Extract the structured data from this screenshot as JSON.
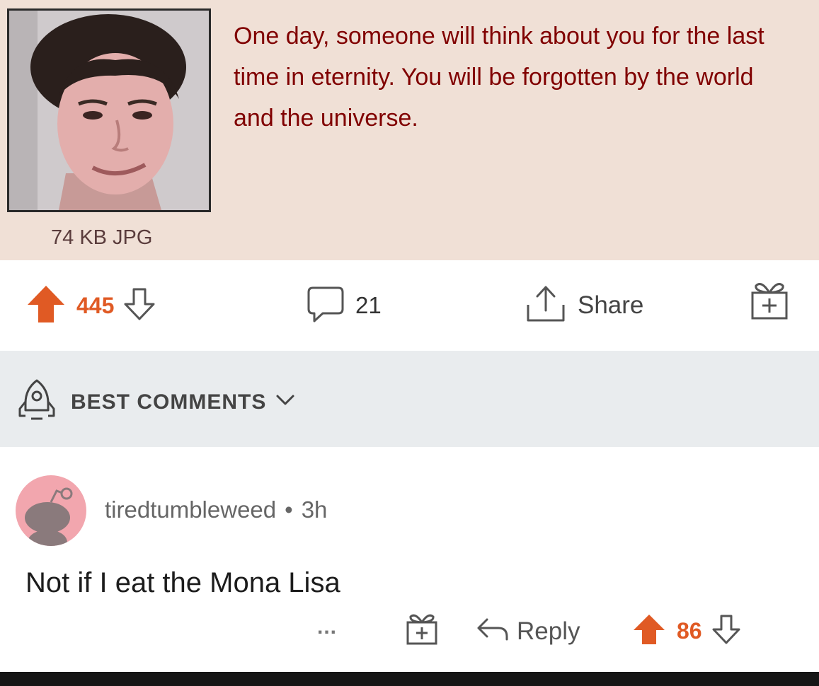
{
  "post": {
    "text": "One day, someone will think about you for the last time in eternity. You will be forgotten by the world and the universe.",
    "file_info": "74 KB JPG"
  },
  "actions": {
    "upvotes": "445",
    "comments": "21",
    "share_label": "Share"
  },
  "sort": {
    "label": "BEST COMMENTS"
  },
  "comment": {
    "username": "tiredtumbleweed",
    "separator": "•",
    "time": "3h",
    "body": "Not if I eat the Mona Lisa",
    "more": "...",
    "reply_label": "Reply",
    "votes": "86"
  },
  "colors": {
    "upvote": "#e05a24",
    "post_background": "#f0e0d6",
    "post_text": "#800000",
    "sort_bar": "#e9ecee"
  },
  "icons": [
    "upvote-arrow-icon",
    "downvote-arrow-icon",
    "comment-bubble-icon",
    "share-icon",
    "award-gift-icon",
    "rocket-icon",
    "chevron-down-icon",
    "snoo-avatar",
    "reply-arrow-icon"
  ]
}
